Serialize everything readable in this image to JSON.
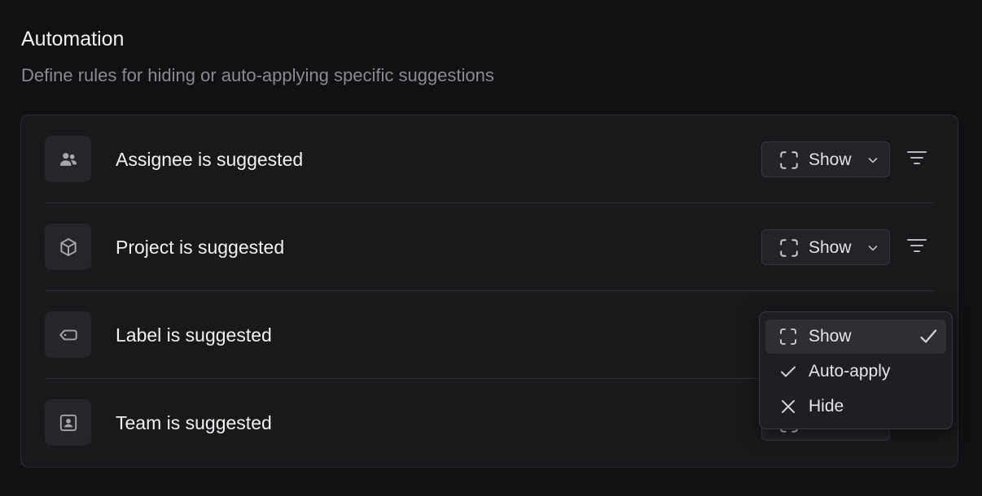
{
  "header": {
    "title": "Automation",
    "subtitle": "Define rules for hiding or auto-applying specific suggestions"
  },
  "rules": [
    {
      "label": "Assignee is suggested",
      "icon": "users-icon",
      "value": "Show"
    },
    {
      "label": "Project is suggested",
      "icon": "cube-icon",
      "value": "Show"
    },
    {
      "label": "Label is suggested",
      "icon": "tag-icon",
      "value": "Show"
    },
    {
      "label": "Team is suggested",
      "icon": "team-badge-icon",
      "value": "Show"
    }
  ],
  "dropdown": {
    "open_for": "Label is suggested",
    "selected": "Show",
    "options": [
      {
        "label": "Show",
        "icon": "dashed-frame-icon"
      },
      {
        "label": "Auto-apply",
        "icon": "check-icon"
      },
      {
        "label": "Hide",
        "icon": "x-icon"
      }
    ]
  },
  "colors": {
    "background": "#111113",
    "card": "#19191c",
    "text": "#f1f1f3",
    "muted": "#8a8a8f"
  }
}
